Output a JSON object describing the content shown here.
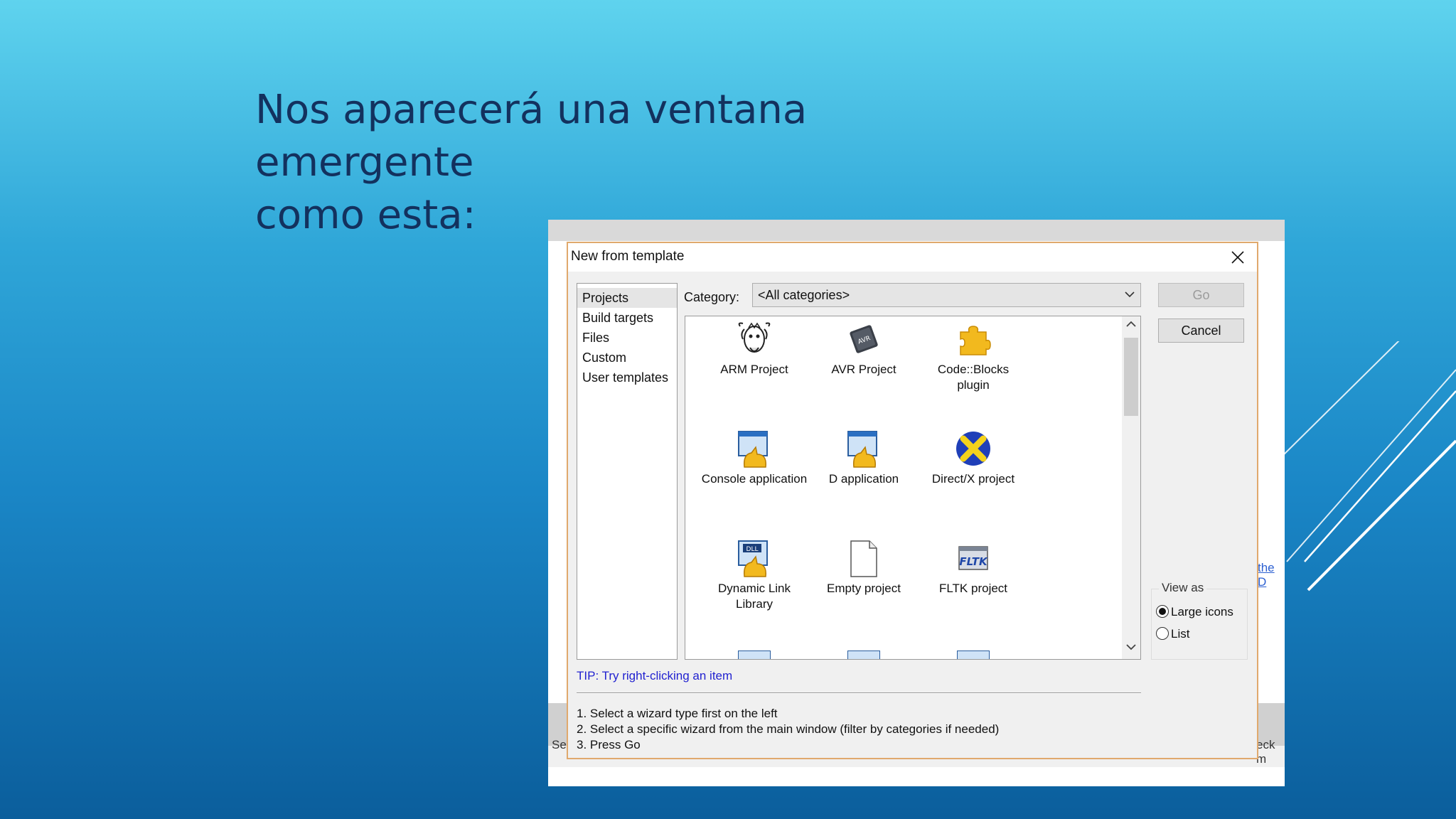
{
  "slide": {
    "title_line1": "Nos aparecerá una ventana emergente",
    "title_line2": "como esta:"
  },
  "background": {
    "left_fragment": "Se",
    "right_fragment": "eck m",
    "link_fragment": "the D"
  },
  "dialog": {
    "title": "New from template",
    "close_icon": "close-icon",
    "left_list": [
      "Projects",
      "Build targets",
      "Files",
      "Custom",
      "User templates"
    ],
    "selected_left": "Projects",
    "category_label": "Category:",
    "category_value": "<All categories>",
    "templates": [
      {
        "label": "ARM Project",
        "icon": "gnu-icon"
      },
      {
        "label": "AVR Project",
        "icon": "avr-chip-icon"
      },
      {
        "label": "Code::Blocks plugin",
        "icon": "puzzle-icon"
      },
      {
        "label": "Console application",
        "icon": "app-icon"
      },
      {
        "label": "D application",
        "icon": "app-icon"
      },
      {
        "label": "Direct/X project",
        "icon": "directx-icon"
      },
      {
        "label": "Dynamic Link Library",
        "icon": "dll-icon"
      },
      {
        "label": "Empty project",
        "icon": "blank-file-icon"
      },
      {
        "label": "FLTK project",
        "icon": "fltk-icon"
      }
    ],
    "go_label": "Go",
    "cancel_label": "Cancel",
    "view_as_label": "View as",
    "view_options": [
      "Large icons",
      "List"
    ],
    "view_selected": "Large icons",
    "tip": "TIP: Try right-clicking an item",
    "instructions": [
      "1. Select a wizard type first on the left",
      "2. Select a specific wizard from the main window (filter by categories if needed)",
      "3. Press Go"
    ]
  },
  "colors": {
    "title_text": "#13315e",
    "dialog_border": "#e0a96d",
    "tip_text": "#2222d0"
  }
}
